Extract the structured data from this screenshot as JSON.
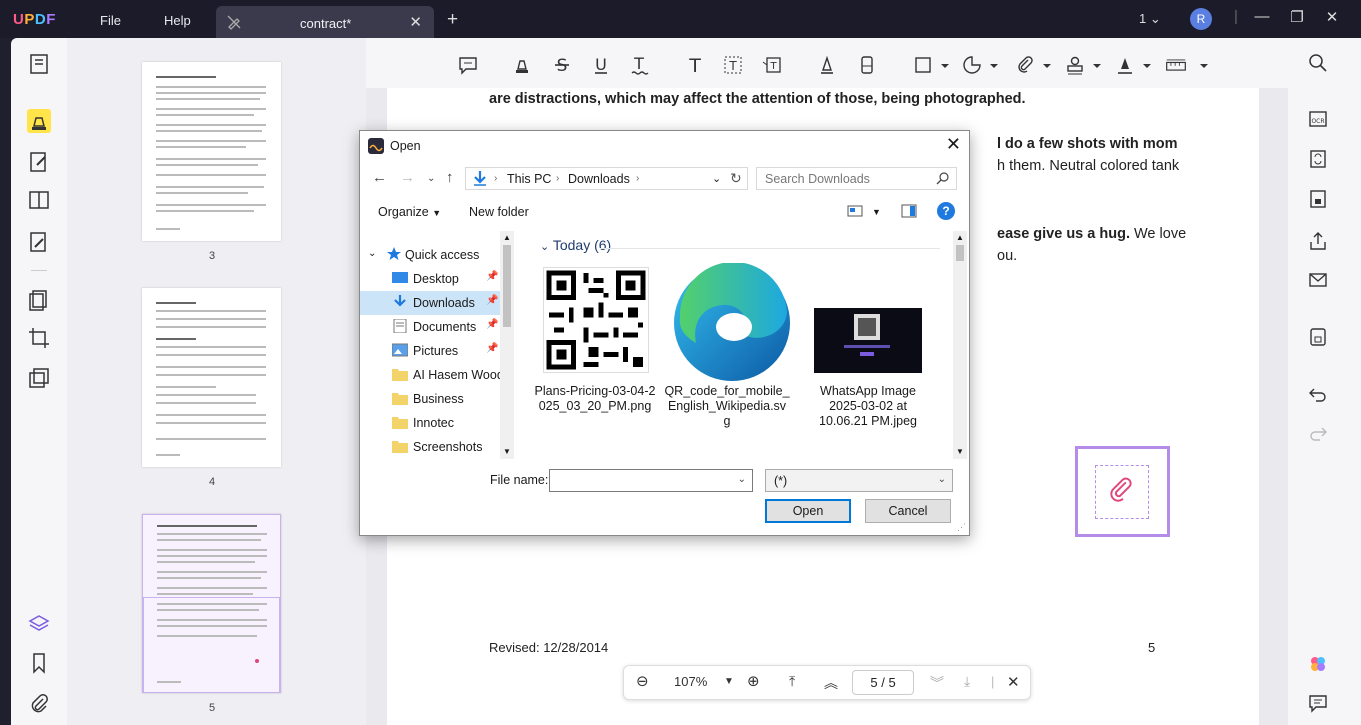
{
  "titlebar": {
    "logo": "UPDF",
    "menu_file": "File",
    "menu_help": "Help",
    "tab_title": "contract*",
    "page_indicator": "1",
    "avatar_letter": "R",
    "colors": {
      "bar": "#1b1b29",
      "tab": "#3a3a4c"
    }
  },
  "thumbnails": {
    "pages": [
      {
        "num": "3"
      },
      {
        "num": "4"
      },
      {
        "num": "5"
      }
    ]
  },
  "document": {
    "line1_bold": "are distractions, which may affect the attention of those, being photographed.",
    "line2_bold": "l do a few shots with mom",
    "line3": "h them. Neutral colored tank",
    "line4_bold": "ease give us a hug.",
    "line4_rest": " We love",
    "line5": "ou.",
    "footer_left": "Revised: 12/28/2014",
    "footer_right": "5",
    "attachment_color": "#b58ce8"
  },
  "zoom": {
    "level": "107%",
    "current_page": "5",
    "separator": "/",
    "total_pages": "5"
  },
  "dialog": {
    "title": "Open",
    "address": {
      "root": "This PC",
      "folder": "Downloads"
    },
    "search_placeholder": "Search Downloads",
    "organize": "Organize",
    "new_folder": "New folder",
    "help": "?",
    "nav": {
      "quick_access": "Quick access",
      "items": [
        {
          "label": "Desktop"
        },
        {
          "label": "Downloads"
        },
        {
          "label": "Documents"
        },
        {
          "label": "Pictures"
        },
        {
          "label": "AI Hasem Wood"
        },
        {
          "label": "Business"
        },
        {
          "label": "Innotec"
        },
        {
          "label": "Screenshots"
        }
      ]
    },
    "group": "Today (6)",
    "files": [
      {
        "name_l1": "Plans-Pricing-03-04-2",
        "name_l2": "025_03_20_PM.png",
        "name_l3": ""
      },
      {
        "name_l1": "QR_code_for_mobile_",
        "name_l2": "English_Wikipedia.sv",
        "name_l3": "g"
      },
      {
        "name_l1": "WhatsApp Image",
        "name_l2": "2025-03-02 at",
        "name_l3": "10.06.21 PM.jpeg"
      }
    ],
    "file_name_label": "File name:",
    "file_name_value": "",
    "file_type": "(*)",
    "open_button": "Open",
    "cancel_button": "Cancel",
    "accent": "#0078d7"
  }
}
